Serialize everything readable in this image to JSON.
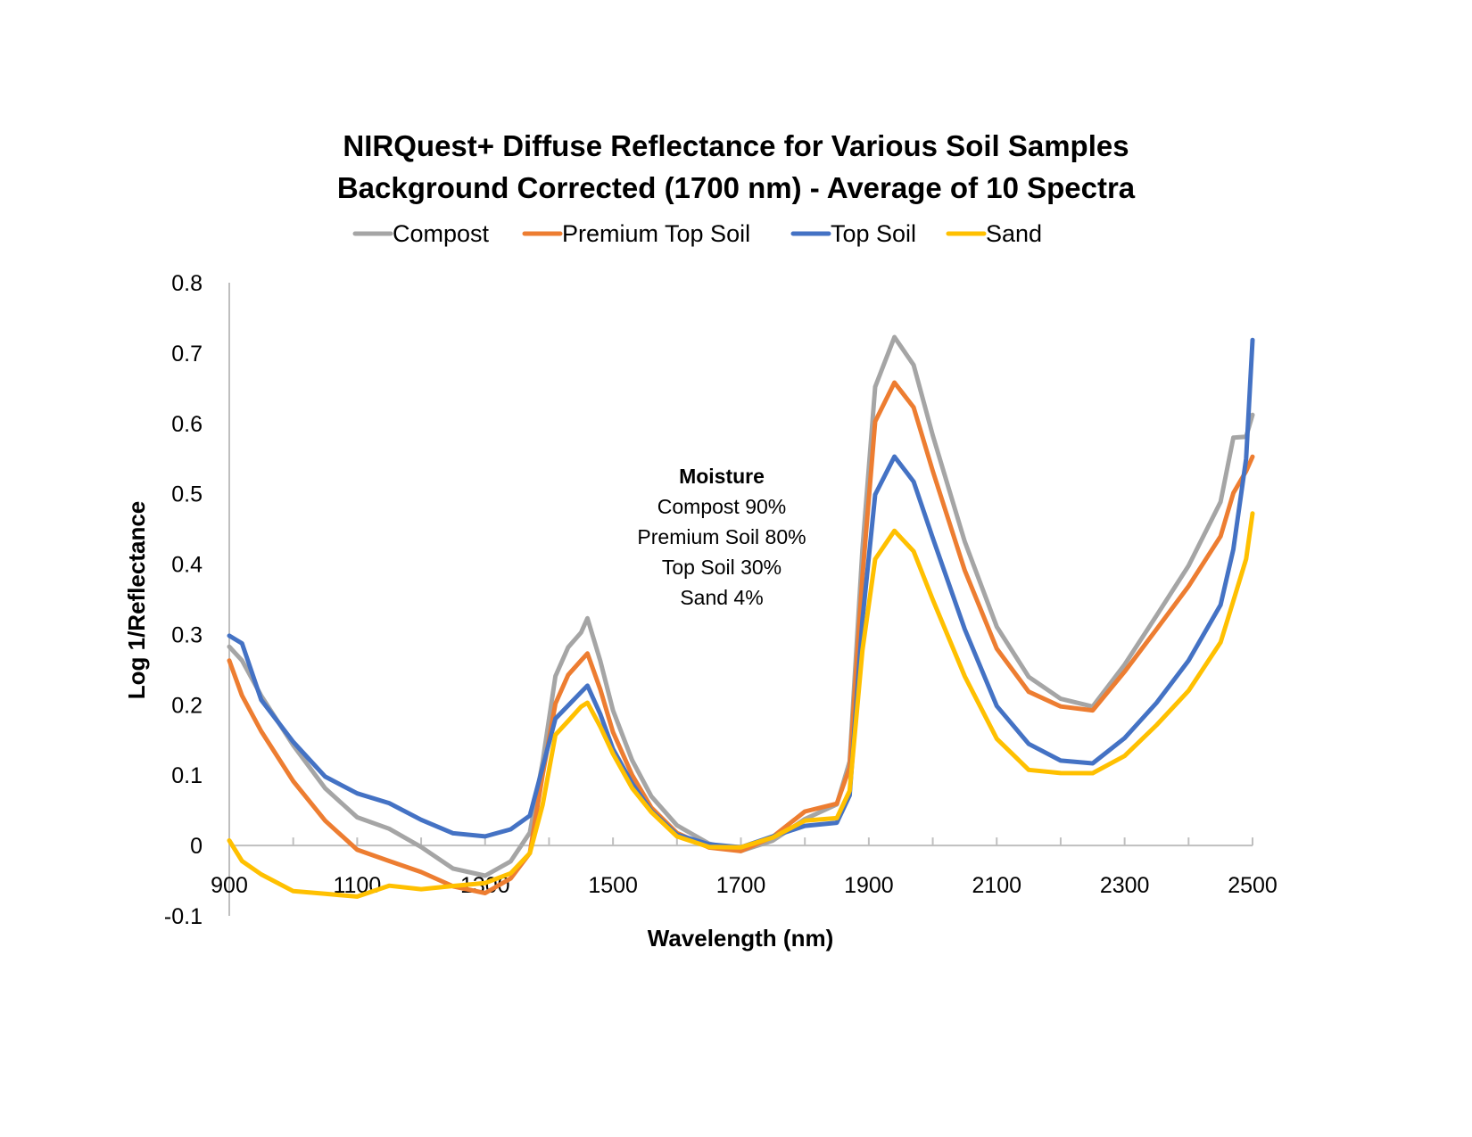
{
  "chart_data": {
    "type": "line",
    "title": "NIRQuest+ Diffuse Reflectance for Various Soil Samples",
    "subtitle": "Background Corrected (1700 nm) - Average of 10 Spectra",
    "xlabel": "Wavelength (nm)",
    "ylabel": "Log 1/Reflectance",
    "xlim": [
      900,
      2500
    ],
    "ylim": [
      -0.1,
      0.8
    ],
    "x_ticks": [
      900,
      1100,
      1300,
      1500,
      1700,
      1900,
      2100,
      2300,
      2500
    ],
    "x_tick_labels": [
      "900",
      "1100",
      "1300",
      "1500",
      "1700",
      "1900",
      "2100",
      "2300",
      "2500"
    ],
    "y_ticks": [
      -0.1,
      0,
      0.1,
      0.2,
      0.3,
      0.4,
      0.5,
      0.6,
      0.7,
      0.8
    ],
    "y_tick_labels": [
      "-0.1",
      "0",
      "0.1",
      "0.2",
      "0.3",
      "0.4",
      "0.5",
      "0.6",
      "0.7",
      "0.8"
    ],
    "grid": false,
    "legend_position": "top",
    "x": [
      900,
      920,
      950,
      1000,
      1050,
      1100,
      1150,
      1200,
      1250,
      1300,
      1340,
      1370,
      1390,
      1410,
      1430,
      1450,
      1460,
      1480,
      1500,
      1530,
      1560,
      1600,
      1650,
      1700,
      1750,
      1800,
      1850,
      1870,
      1890,
      1910,
      1940,
      1970,
      2000,
      2050,
      2100,
      2150,
      2200,
      2250,
      2300,
      2350,
      2400,
      2450,
      2470,
      2490,
      2500
    ],
    "series": [
      {
        "name": "Compost",
        "color": "#A5A5A5",
        "values": [
          0.28,
          0.26,
          0.21,
          0.14,
          0.08,
          0.04,
          0.025,
          0.0,
          -0.03,
          -0.04,
          -0.02,
          0.02,
          0.12,
          0.24,
          0.28,
          0.3,
          0.32,
          0.26,
          0.19,
          0.12,
          0.07,
          0.03,
          0.005,
          -0.005,
          0.01,
          0.04,
          0.06,
          0.12,
          0.42,
          0.65,
          0.72,
          0.68,
          0.58,
          0.43,
          0.31,
          0.24,
          0.21,
          0.2,
          0.26,
          0.33,
          0.4,
          0.49,
          0.58,
          0.58,
          0.61
        ]
      },
      {
        "name": "Premium Top Soil",
        "color": "#ED7D31",
        "values": [
          0.26,
          0.21,
          0.16,
          0.09,
          0.035,
          -0.005,
          -0.02,
          -0.035,
          -0.055,
          -0.065,
          -0.045,
          -0.01,
          0.1,
          0.2,
          0.24,
          0.26,
          0.27,
          0.22,
          0.16,
          0.1,
          0.055,
          0.02,
          0.0,
          -0.005,
          0.015,
          0.05,
          0.06,
          0.11,
          0.38,
          0.6,
          0.655,
          0.62,
          0.53,
          0.39,
          0.28,
          0.22,
          0.2,
          0.195,
          0.25,
          0.31,
          0.37,
          0.44,
          0.5,
          0.53,
          0.55
        ]
      },
      {
        "name": "Top Soil",
        "color": "#4472C4",
        "values": [
          0.3,
          0.29,
          0.21,
          0.15,
          0.1,
          0.075,
          0.06,
          0.035,
          0.015,
          0.01,
          0.02,
          0.04,
          0.11,
          0.18,
          0.2,
          0.22,
          0.23,
          0.19,
          0.14,
          0.09,
          0.05,
          0.015,
          0.0,
          -0.005,
          0.01,
          0.025,
          0.03,
          0.07,
          0.32,
          0.5,
          0.555,
          0.52,
          0.44,
          0.31,
          0.2,
          0.145,
          0.12,
          0.115,
          0.15,
          0.2,
          0.26,
          0.34,
          0.42,
          0.55,
          0.72
        ]
      },
      {
        "name": "Sand",
        "color": "#FFC000",
        "values": [
          0.01,
          -0.02,
          -0.04,
          -0.065,
          -0.07,
          -0.075,
          -0.06,
          -0.065,
          -0.06,
          -0.055,
          -0.04,
          -0.01,
          0.06,
          0.16,
          0.18,
          0.2,
          0.205,
          0.17,
          0.13,
          0.08,
          0.045,
          0.01,
          -0.005,
          -0.005,
          0.01,
          0.035,
          0.04,
          0.08,
          0.28,
          0.41,
          0.45,
          0.42,
          0.35,
          0.24,
          0.15,
          0.105,
          0.1,
          0.1,
          0.125,
          0.17,
          0.22,
          0.29,
          0.35,
          0.41,
          0.475
        ]
      }
    ],
    "annotation": {
      "heading": "Moisture",
      "lines": [
        "Compost 90%",
        "Premium Soil 80%",
        "Top Soil 30%",
        "Sand 4%"
      ],
      "anchor": {
        "x": 1700,
        "y": 0.52
      }
    }
  }
}
